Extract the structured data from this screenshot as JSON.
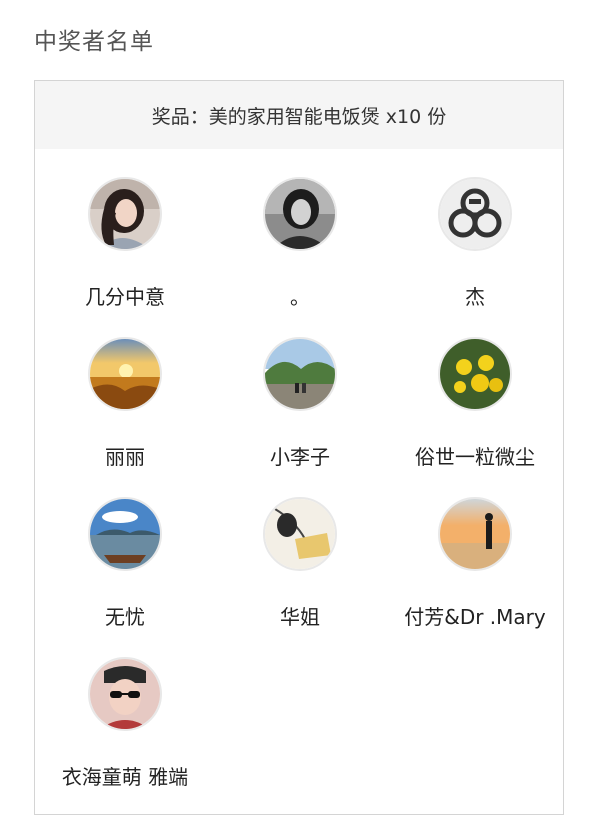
{
  "page": {
    "title": "中奖者名单"
  },
  "prize": {
    "label": "奖品：美的家用智能电饭煲 x10 份"
  },
  "winners": [
    {
      "name": "几分中意",
      "avatar": "woman-portrait-avatar"
    },
    {
      "name": "。",
      "avatar": "bw-portrait-avatar"
    },
    {
      "name": "杰",
      "avatar": "emblem-logo-avatar"
    },
    {
      "name": "丽丽",
      "avatar": "sunset-field-avatar"
    },
    {
      "name": "小李子",
      "avatar": "landscape-couple-avatar"
    },
    {
      "name": "俗世一粒微尘",
      "avatar": "yellow-flowers-avatar"
    },
    {
      "name": "无忧",
      "avatar": "lake-boat-avatar"
    },
    {
      "name": "华姐",
      "avatar": "sketch-illustration-avatar"
    },
    {
      "name": "付芳&Dr .Mary",
      "avatar": "beach-silhouette-avatar"
    },
    {
      "name": "衣海童萌 雅端",
      "avatar": "sunglasses-woman-avatar"
    }
  ]
}
